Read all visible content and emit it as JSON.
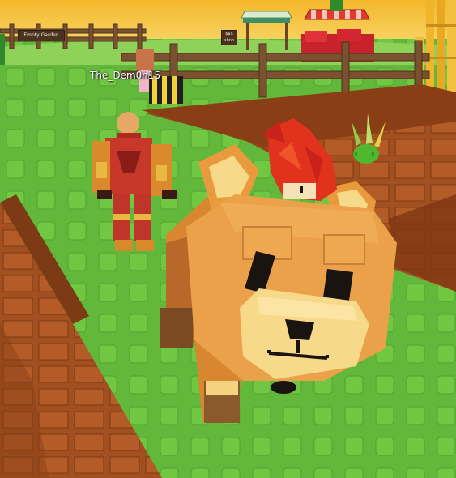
{
  "game": {
    "player_name": "The_Dem0n15",
    "signs": {
      "garden_sign": "Empty Garden",
      "price_sign_line1": "$$$",
      "price_sign_line2": "shop"
    }
  },
  "colors": {
    "sky": "#f2c23a",
    "grass": "#62b83a",
    "dirt": "#9a4a1e",
    "fence": "#7a5230",
    "fox_orange": "#e99a3c",
    "fox_cream": "#f7d98a",
    "fox_dark": "#1a1410",
    "hair_red": "#e0321c"
  }
}
